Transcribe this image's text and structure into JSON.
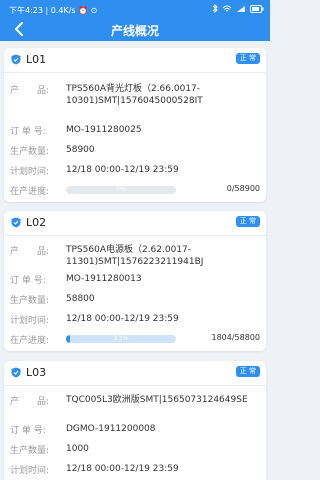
{
  "status_bar": {
    "time_info": "下午4:23 | 0.4K/s ⏰ ⊙"
  },
  "header": {
    "title": "产线概况"
  },
  "labels": {
    "product": "产　　品:",
    "order": "订 单 号:",
    "quantity": "生产数量:",
    "plan_time": "计划时间:",
    "progress": "在产进度:"
  },
  "colors": {
    "primary": "#2f8ff0",
    "background": "#eef2f7"
  },
  "cards": [
    {
      "line": "L01",
      "status": "正 常",
      "product": "TPS560A背光灯板（2.66.0017-10301)SMT|1576045000528IT",
      "order": "MO-1911280025",
      "quantity": "58900",
      "plan_time": "12/18 00:00-12/19 23:59",
      "progress_pct": "0%",
      "progress_value": 0.0,
      "progress_count": "0/58900"
    },
    {
      "line": "L02",
      "status": "正 常",
      "product": "TPS560A电源板（2.62.0017-11301)SMT|1576223211941BJ",
      "order": "MO-1911280013",
      "quantity": "58800",
      "plan_time": "12/18 00:00-12/19 23:59",
      "progress_pct": "3.1%",
      "progress_value": 0.031,
      "progress_count": "1804/58800"
    },
    {
      "line": "L03",
      "status": "正 常",
      "product": "TQC005L3欧洲版SMT|1565073124649SE",
      "order": "DGMO-1911200008",
      "quantity": "1000",
      "plan_time": "12/18 00:00-12/19 23:59"
    }
  ]
}
